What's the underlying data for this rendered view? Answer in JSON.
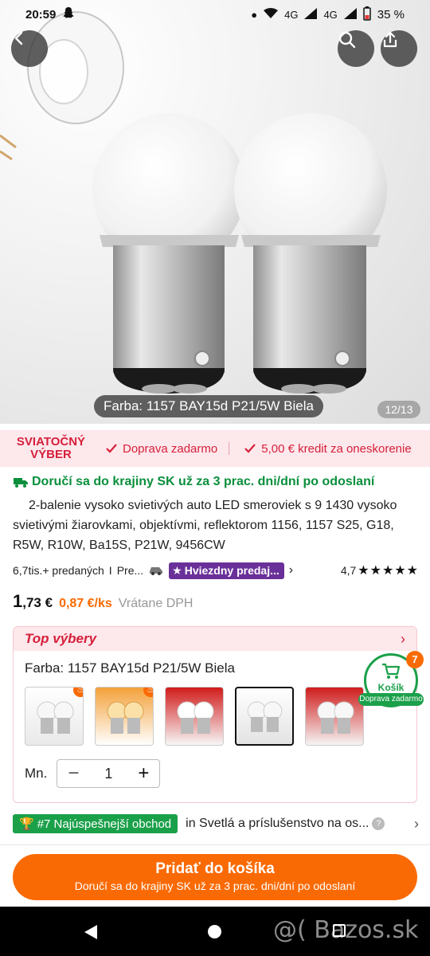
{
  "status_bar": {
    "time": "20:59",
    "network_1": "4G",
    "network_2": "4G",
    "battery": "35 %"
  },
  "hero": {
    "color_caption": "Farba: 1157 BAY15d P21/5W Biela",
    "image_counter": "12/13"
  },
  "holiday_banner": {
    "tag_line1": "SVIATOČNÝ",
    "tag_line2": "VÝBER",
    "perk_1": "Doprava zadarmo",
    "perk_2": "5,00 € kredit za oneskorenie",
    "accent": "#d6203b"
  },
  "product": {
    "delivery": "Doručí sa do krajiny SK už za 3 prac. dni/dní po odoslaní",
    "title": "2-balenie vysoko svietivých auto LED smeroviek s 9 1430 vysoko svietivými žiarovkami, objektívmi, reflektorom 1156, 1157 S25, G18, R5W, R10W, Ba15S, P21W, 9456CW",
    "sold": "6,7tis.+ predaných",
    "sold_divider": "I",
    "pre": "Pre...",
    "star_seller": "Hviezdny predaj...",
    "rating": "4,7",
    "stars": "★★★★★"
  },
  "price": {
    "whole": "1",
    "cents": ",73 €",
    "per_unit": "0,87 €/ks",
    "vat_note": "Vrátane DPH"
  },
  "top_picks": {
    "label": "Top výbery",
    "color_label": "Farba: 1157 BAY15d P21/5W Biela",
    "quantity_label": "Mn.",
    "quantity_value": "1",
    "swatches": [
      {
        "name": "white-bulb",
        "hot": true
      },
      {
        "name": "amber-bulb",
        "hot": true
      },
      {
        "name": "red-glow-bulb",
        "hot": false
      },
      {
        "name": "white-bulb-selected",
        "hot": false
      },
      {
        "name": "red-bulb",
        "hot": false
      }
    ]
  },
  "cart": {
    "count": "7",
    "label": "Košík",
    "free_shipping": "Doprava zadarmo"
  },
  "store": {
    "badge": "#7 Najúspešnejší obchod",
    "category": "in Svetlá a príslušenstvo na os...",
    "help": "?"
  },
  "add_to_cart": {
    "label": "Pridať do košíka",
    "sub": "Doručí sa do krajiny SK už za 3 prac. dni/dní po odoslaní"
  },
  "watermark": "@(  Bazos.sk"
}
